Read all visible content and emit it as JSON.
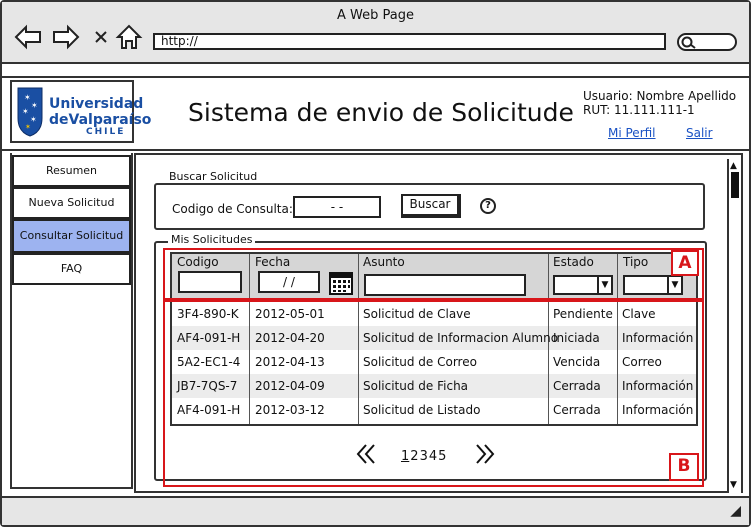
{
  "browser": {
    "window_title": "A Web Page",
    "url": "http://"
  },
  "logo": {
    "line1": "Universidad",
    "line2": "deValparaíso",
    "country": "CHILE"
  },
  "header": {
    "title": "Sistema de envio de Solicitude",
    "user_label": "Usuario: Nombre Apellido",
    "rut_label": "RUT: 11.111.111-1",
    "profile_link": "Mi Perfil",
    "logout_link": "Salir"
  },
  "sidebar": {
    "items": [
      {
        "label": "Resumen"
      },
      {
        "label": "Nueva Solicitud"
      },
      {
        "label": "Consultar Solicitud",
        "active": true
      },
      {
        "label": "FAQ"
      }
    ]
  },
  "search": {
    "legend": "Buscar Solicitud",
    "field_label": "Codigo de Consulta:",
    "field_value": "-  -",
    "button_label": "Buscar"
  },
  "requests": {
    "legend": "Mis Solicitudes",
    "columns": [
      "Codigo",
      "Fecha",
      "Asunto",
      "Estado",
      "Tipo"
    ],
    "date_filter_value": "/ /",
    "rows": [
      [
        "3F4-890-K",
        "2012-05-01",
        "Solicitud de Clave",
        "Pendiente",
        "Clave"
      ],
      [
        "AF4-091-H",
        "2012-04-20",
        "Solicitud de Informacion Alumno",
        "Iniciada",
        "Información"
      ],
      [
        "5A2-EC1-4",
        "2012-04-13",
        "Solicitud de Correo",
        "Vencida",
        "Correo"
      ],
      [
        "JB7-7QS-7",
        "2012-04-09",
        "Solicitud de Ficha",
        "Cerrada",
        "Información"
      ],
      [
        "AF4-091-H",
        "2012-03-12",
        "Solicitud de Listado",
        "Cerrada",
        "Información"
      ]
    ]
  },
  "pagination": {
    "pages": [
      "1",
      "2",
      "3",
      "4",
      "5"
    ],
    "current": "1"
  },
  "annotations": {
    "a": "A",
    "b": "B",
    "color": "#d8161a"
  },
  "colors": {
    "active_nav": "#9db3f0",
    "brand": "#1a4fa3",
    "link": "#1a52c4"
  }
}
